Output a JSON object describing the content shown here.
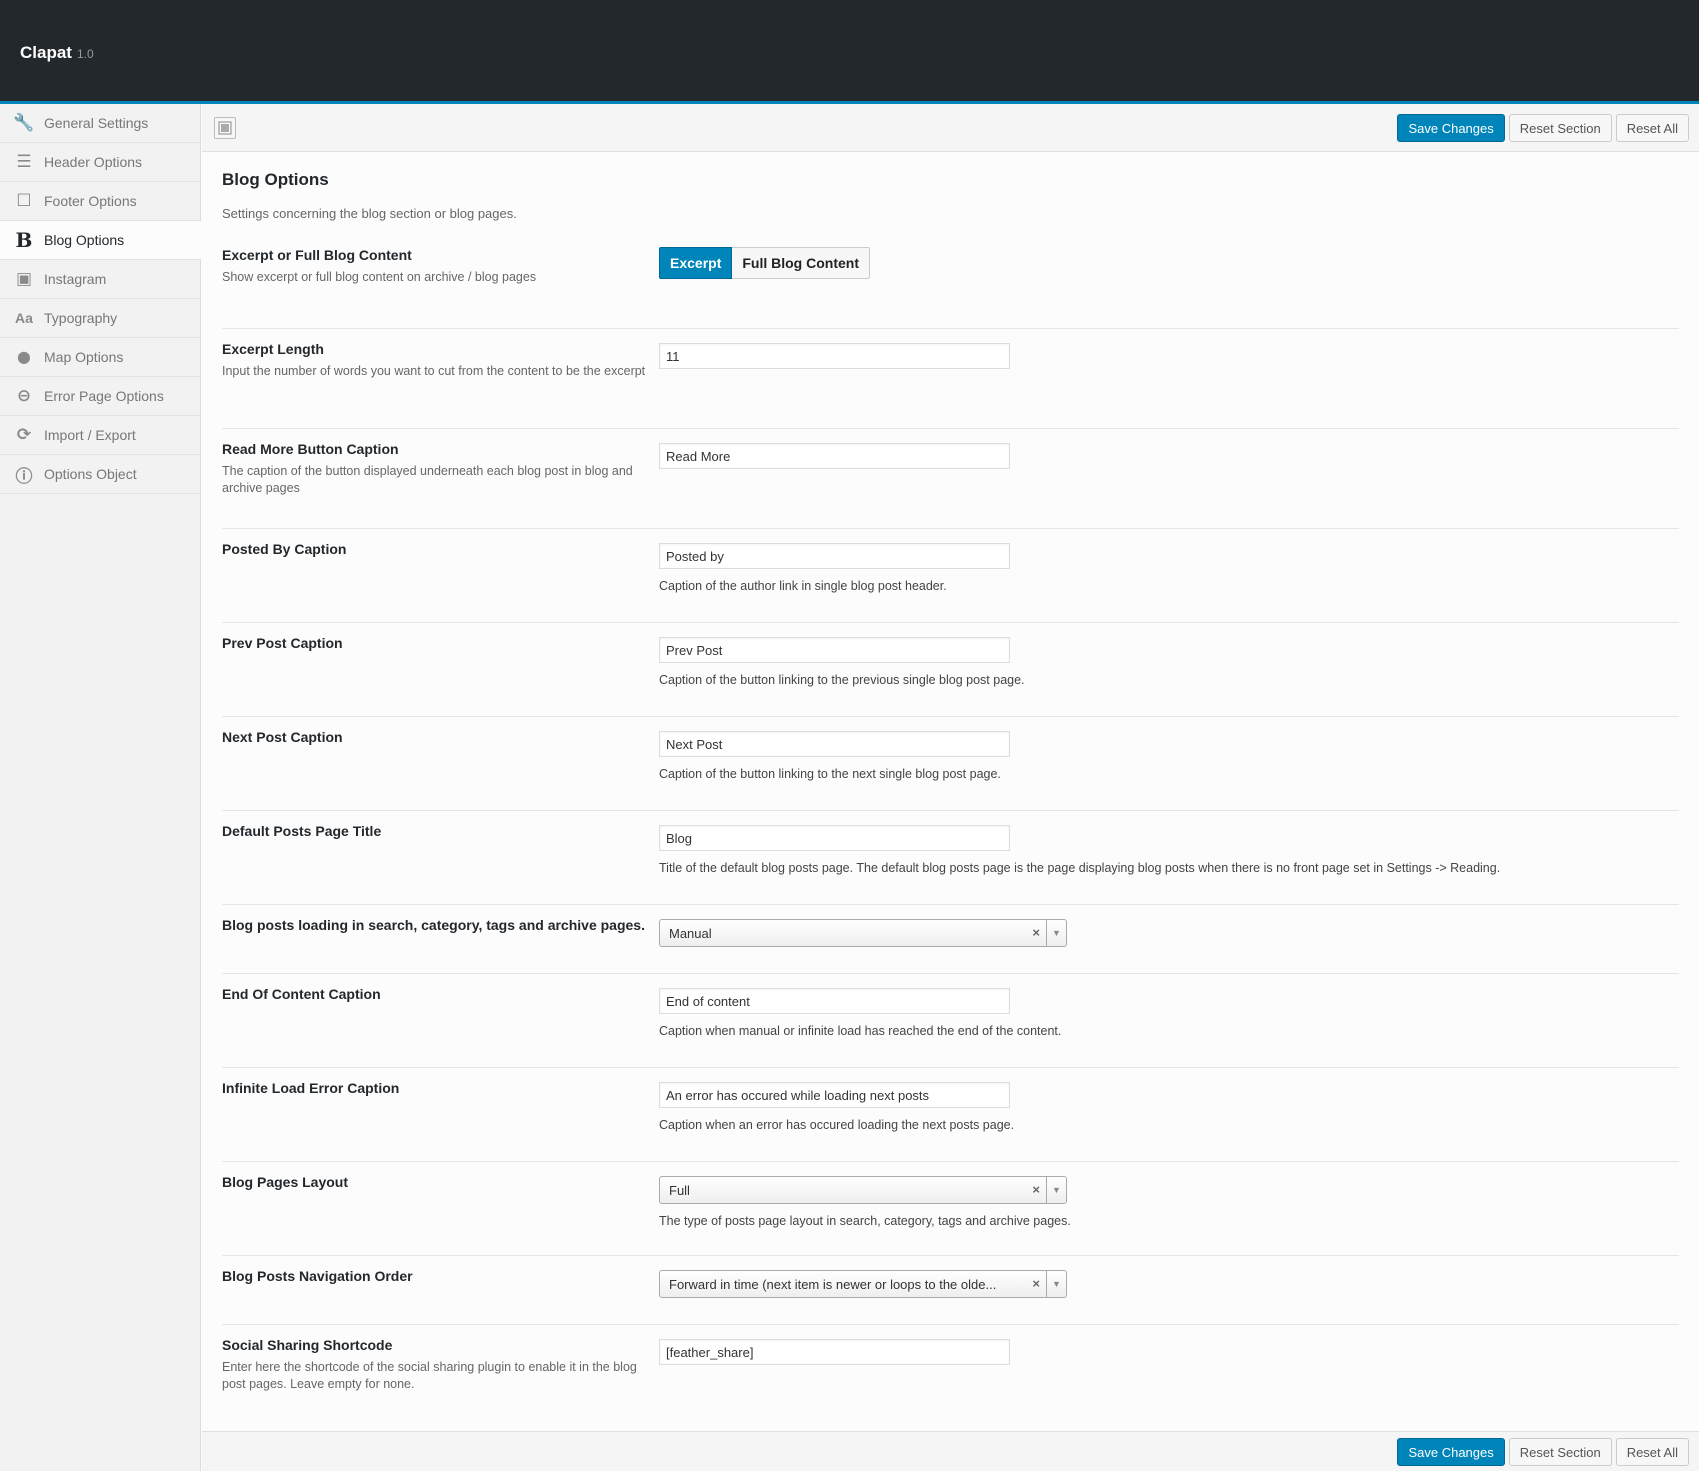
{
  "brand": {
    "name": "Clapat",
    "version": "1.0"
  },
  "sidebar": {
    "items": [
      {
        "label": "General Settings",
        "icon": "wrench-icon",
        "glyph": "🔧"
      },
      {
        "label": "Header Options",
        "icon": "menu-icon",
        "glyph": "☰"
      },
      {
        "label": "Footer Options",
        "icon": "square-icon",
        "glyph": "☐"
      },
      {
        "label": "Blog Options",
        "icon": "bold-b-icon",
        "glyph": "B"
      },
      {
        "label": "Instagram",
        "icon": "instagram-icon",
        "glyph": "▣"
      },
      {
        "label": "Typography",
        "icon": "font-icon",
        "glyph": "Aa"
      },
      {
        "label": "Map Options",
        "icon": "map-pin-icon",
        "glyph": "⬤"
      },
      {
        "label": "Error Page Options",
        "icon": "minus-circle-icon",
        "glyph": "⊖"
      },
      {
        "label": "Import / Export",
        "icon": "refresh-icon",
        "glyph": "⟳"
      },
      {
        "label": "Options Object",
        "icon": "info-icon",
        "glyph": "ⓘ"
      }
    ]
  },
  "toolbar": {
    "save": "Save Changes",
    "reset_section": "Reset Section",
    "reset_all": "Reset All"
  },
  "section": {
    "title": "Blog Options",
    "desc": "Settings concerning the blog section or blog pages."
  },
  "fields": {
    "excerpt": {
      "title": "Excerpt or Full Blog Content",
      "sub": "Show excerpt or full blog content on archive / blog pages",
      "opt_on": "Excerpt",
      "opt_off": "Full Blog Content"
    },
    "excerpt_length": {
      "title": "Excerpt Length",
      "sub": "Input the number of words you want to cut from the content to be the excerpt",
      "value": "11"
    },
    "read_more": {
      "title": "Read More Button Caption",
      "sub": "The caption of the button displayed underneath each blog post in blog and archive pages",
      "value": "Read More"
    },
    "posted_by": {
      "title": "Posted By Caption",
      "value": "Posted by",
      "desc": "Caption of the author link in single blog post header."
    },
    "prev_post": {
      "title": "Prev Post Caption",
      "value": "Prev Post",
      "desc": "Caption of the button linking to the previous single blog post page."
    },
    "next_post": {
      "title": "Next Post Caption",
      "value": "Next Post",
      "desc": "Caption of the button linking to the next single blog post page."
    },
    "default_title": {
      "title": "Default Posts Page Title",
      "value": "Blog",
      "desc": "Title of the default blog posts page. The default blog posts page is the page displaying blog posts when there is no front page set in Settings -> Reading."
    },
    "loading": {
      "title": "Blog posts loading in search, category, tags and archive pages.",
      "value": "Manual"
    },
    "end_content": {
      "title": "End Of Content Caption",
      "value": "End of content",
      "desc": "Caption when manual or infinite load has reached the end of the content."
    },
    "load_error": {
      "title": "Infinite Load Error Caption",
      "value": "An error has occured while loading next posts",
      "desc": "Caption when an error has occured loading the next posts page."
    },
    "layout": {
      "title": "Blog Pages Layout",
      "value": "Full",
      "desc": "The type of posts page layout in search, category, tags and archive pages."
    },
    "nav_order": {
      "title": "Blog Posts Navigation Order",
      "value": "Forward in time (next item is newer or loops to the olde..."
    },
    "social": {
      "title": "Social Sharing Shortcode",
      "sub": "Enter here the shortcode of the social sharing plugin to enable it in the blog post pages. Leave empty for none.",
      "value": "[feather_share]"
    }
  },
  "colors": {
    "topbar": "#23282d",
    "accent": "#0085ba"
  }
}
